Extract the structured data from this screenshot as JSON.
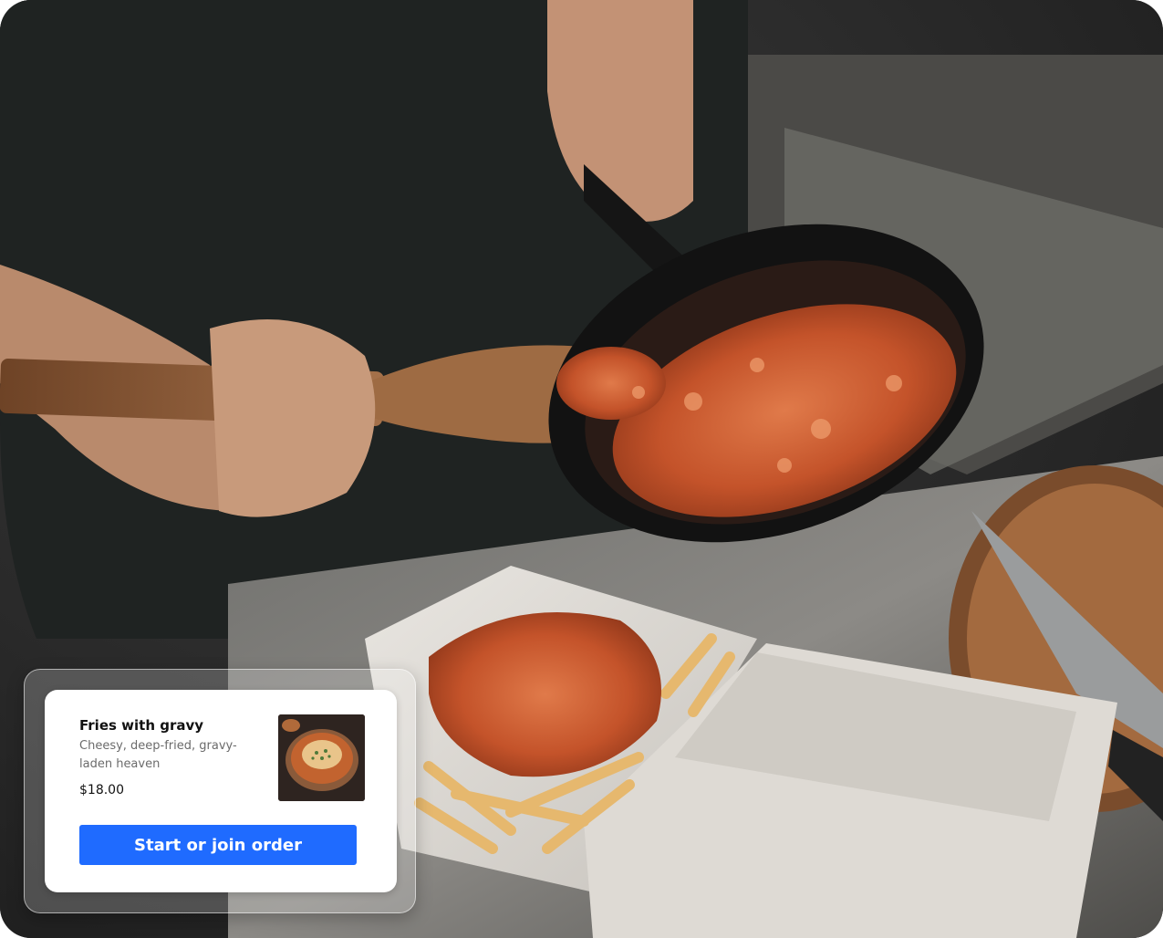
{
  "menu_item": {
    "title": "Fries with gravy",
    "description": "Cheesy, deep-fried, gravy-laden heaven",
    "price": "$18.00",
    "cta_label": "Start or join order"
  },
  "colors": {
    "cta_background": "#1f6bff",
    "cta_text": "#ffffff",
    "card_background": "#ffffff"
  }
}
